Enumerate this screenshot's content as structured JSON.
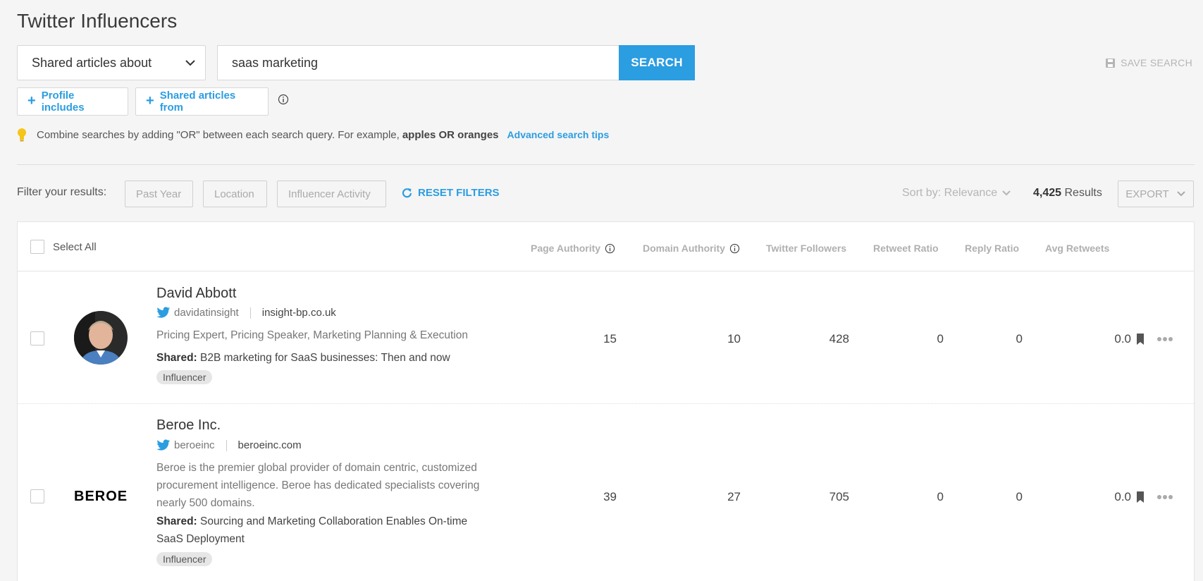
{
  "page": {
    "title": "Twitter Influencers"
  },
  "search": {
    "select_value": "Shared articles about",
    "query": "saas marketing",
    "search_label": "SEARCH",
    "save_label": "SAVE SEARCH"
  },
  "add_buttons": {
    "profile": "Profile includes",
    "shared_from": "Shared articles from"
  },
  "tip": {
    "text": "Combine searches by adding \"OR\" between each search query. For example,",
    "example": "apples OR oranges",
    "link": "Advanced search tips"
  },
  "filters": {
    "label": "Filter your results:",
    "chips": [
      "Past Year",
      "Location",
      "Influencer Activity"
    ],
    "reset": "RESET FILTERS",
    "sort": "Sort by: Relevance",
    "results_count": "4,425",
    "results_label": "Results",
    "export": "EXPORT"
  },
  "table": {
    "select_all": "Select All",
    "columns": [
      "Page Authority",
      "Domain Authority",
      "Twitter Followers",
      "Retweet Ratio",
      "Reply Ratio",
      "Avg Retweets"
    ],
    "rows": [
      {
        "name": "David Abbott",
        "handle": "davidatinsight",
        "site": "insight-bp.co.uk",
        "bio": "Pricing Expert, Pricing Speaker, Marketing Planning & Execution",
        "shared_label": "Shared:",
        "shared": "B2B marketing for SaaS businesses: Then and now",
        "tag": "Influencer",
        "metrics": [
          "15",
          "10",
          "428",
          "0",
          "0",
          "0.0"
        ]
      },
      {
        "name": "Beroe Inc.",
        "handle": "beroeinc",
        "site": "beroeinc.com",
        "bio": "Beroe is the premier global provider of domain centric, customized procurement intelligence. Beroe has dedicated specialists covering nearly 500 domains.",
        "shared_label": "Shared:",
        "shared": "Sourcing and Marketing Collaboration Enables On-time SaaS Deployment",
        "tag": "Influencer",
        "logo_text": "BEROE",
        "metrics": [
          "39",
          "27",
          "705",
          "0",
          "0",
          "0.0"
        ]
      }
    ]
  },
  "colors": {
    "accent": "#2b9de1",
    "bulb": "#f5c518"
  }
}
